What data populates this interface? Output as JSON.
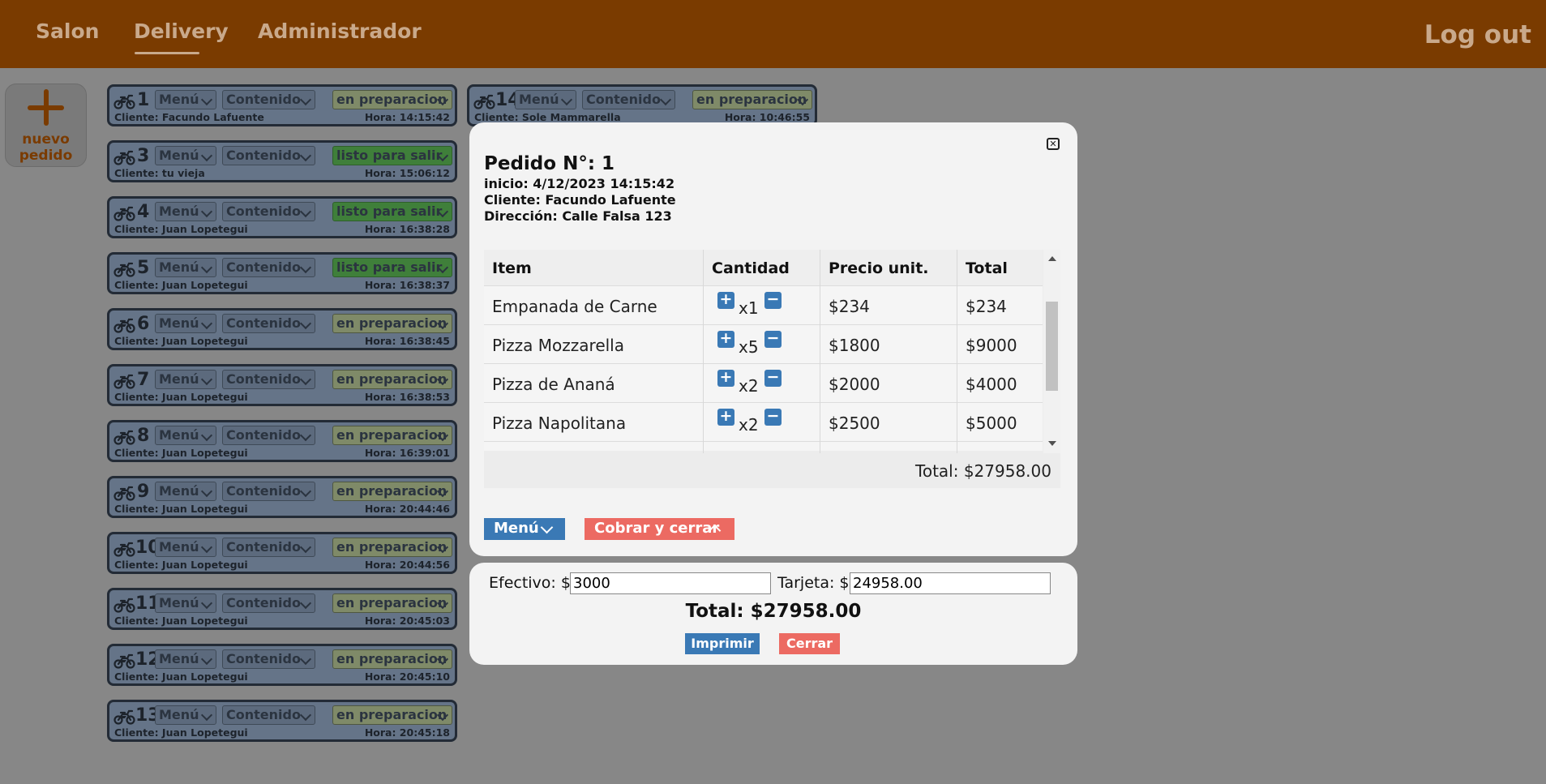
{
  "nav": {
    "items": [
      "Salon",
      "Delivery",
      "Administrador"
    ],
    "active": "Delivery",
    "logout": "Log out"
  },
  "new_order": {
    "line1": "nuevo",
    "line2": "pedido",
    "icon": "plus-icon"
  },
  "orders": [
    {
      "num": "1",
      "menu": "Menú",
      "contenido": "Contenido",
      "status": "en preparacion",
      "cliente": "Cliente: Facundo Lafuente",
      "hora": "Hora: 14:15:42"
    },
    {
      "num": "3",
      "menu": "Menú",
      "contenido": "Contenido",
      "status": "listo para salir",
      "cliente": "Cliente: tu vieja",
      "hora": "Hora: 15:06:12"
    },
    {
      "num": "4",
      "menu": "Menú",
      "contenido": "Contenido",
      "status": "listo para salir",
      "cliente": "Cliente: Juan Lopetegui",
      "hora": "Hora: 16:38:28"
    },
    {
      "num": "5",
      "menu": "Menú",
      "contenido": "Contenido",
      "status": "listo para salir",
      "cliente": "Cliente: Juan Lopetegui",
      "hora": "Hora: 16:38:37"
    },
    {
      "num": "6",
      "menu": "Menú",
      "contenido": "Contenido",
      "status": "en preparacion",
      "cliente": "Cliente: Juan Lopetegui",
      "hora": "Hora: 16:38:45"
    },
    {
      "num": "7",
      "menu": "Menú",
      "contenido": "Contenido",
      "status": "en preparacion",
      "cliente": "Cliente: Juan Lopetegui",
      "hora": "Hora: 16:38:53"
    },
    {
      "num": "8",
      "menu": "Menú",
      "contenido": "Contenido",
      "status": "en preparacion",
      "cliente": "Cliente: Juan Lopetegui",
      "hora": "Hora: 16:39:01"
    },
    {
      "num": "9",
      "menu": "Menú",
      "contenido": "Contenido",
      "status": "en preparacion",
      "cliente": "Cliente: Juan Lopetegui",
      "hora": "Hora: 20:44:46"
    },
    {
      "num": "10",
      "menu": "Menú",
      "contenido": "Contenido",
      "status": "en preparacion",
      "cliente": "Cliente: Juan Lopetegui",
      "hora": "Hora: 20:44:56"
    },
    {
      "num": "11",
      "menu": "Menú",
      "contenido": "Contenido",
      "status": "en preparacion",
      "cliente": "Cliente: Juan Lopetegui",
      "hora": "Hora: 20:45:03"
    },
    {
      "num": "12",
      "menu": "Menú",
      "contenido": "Contenido",
      "status": "en preparacion",
      "cliente": "Cliente: Juan Lopetegui",
      "hora": "Hora: 20:45:10"
    },
    {
      "num": "13",
      "menu": "Menú",
      "contenido": "Contenido",
      "status": "en preparacion",
      "cliente": "Cliente: Juan Lopetegui",
      "hora": "Hora: 20:45:18"
    },
    {
      "num": "14",
      "menu": "Menú",
      "contenido": "Contenido",
      "status": "en preparacion",
      "cliente": "Cliente: Sole Mammarella",
      "hora": "Hora: 10:46:55"
    }
  ],
  "modal": {
    "title": "Pedido N°: 1",
    "inicio": "inicio: 4/12/2023 14:15:42",
    "cliente": "Cliente: Facundo Lafuente",
    "direccion": "Dirección: Calle Falsa 123",
    "columns": [
      "Item",
      "Cantidad",
      "Precio unit.",
      "Total"
    ],
    "rows": [
      {
        "item": "Empanada de Carne",
        "qty": "x1",
        "price": "$234",
        "total": "$234"
      },
      {
        "item": "Pizza Mozzarella",
        "qty": "x5",
        "price": "$1800",
        "total": "$9000"
      },
      {
        "item": "Pizza de Ananá",
        "qty": "x2",
        "price": "$2000",
        "total": "$4000"
      },
      {
        "item": "Pizza Napolitana",
        "qty": "x2",
        "price": "$2500",
        "total": "$5000"
      }
    ],
    "table_total": "Total: $27958.00",
    "menu_button": "Menú",
    "cobrar_button": "Cobrar y cerrar"
  },
  "payment": {
    "efectivo_label": "Efectivo: $",
    "efectivo_value": "3000",
    "tarjeta_label": "Tarjeta: $",
    "tarjeta_value": "24958.00",
    "total": "Total: $27958.00",
    "print_button": "Imprimir",
    "close_button": "Cerrar"
  },
  "colors": {
    "topbar": "#7a3b00",
    "accent_blue": "#3a79b5",
    "accent_red": "#ec6a62",
    "ready_green": "#3f7f3a"
  }
}
